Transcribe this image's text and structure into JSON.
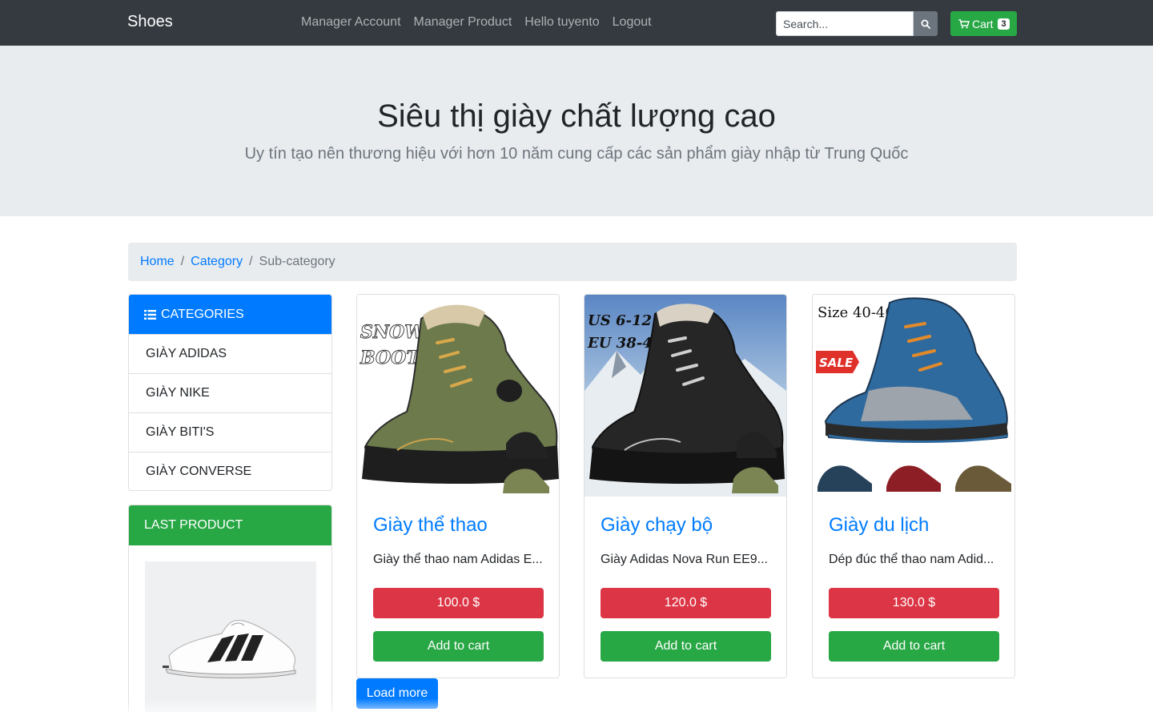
{
  "navbar": {
    "brand": "Shoes",
    "links": [
      "Manager Account",
      "Manager Product",
      "Hello tuyento",
      "Logout"
    ],
    "search_placeholder": "Search...",
    "cart_label": "Cart",
    "cart_count": "3",
    "icons": {
      "search": "search-icon",
      "cart": "cart-icon"
    }
  },
  "jumbotron": {
    "title": "Siêu thị giày chất lượng cao",
    "lead": "Uy tín tạo nên thương hiệu với hơn 10 năm cung cấp các sản phẩm giày nhập từ Trung Quốc"
  },
  "breadcrumb": {
    "home": "Home",
    "category": "Category",
    "active": "Sub-category"
  },
  "categories": {
    "header": "CATEGORIES",
    "items": [
      "GIÀY ADIDAS",
      "GIÀY NIKE",
      "GIÀY BITI'S",
      "GIÀY CONVERSE"
    ]
  },
  "last_product": {
    "header": "LAST PRODUCT"
  },
  "products": [
    {
      "title": "Giày thể thao",
      "desc": "Giày thể thao nam Adidas E...",
      "price": "100.0 $",
      "add_label": "Add to cart",
      "image_text": [
        "SNOW",
        "BOOTS"
      ]
    },
    {
      "title": "Giày chạy bộ",
      "desc": "Giày Adidas Nova Run EE9...",
      "price": "120.0 $",
      "add_label": "Add to cart",
      "image_text": [
        "US 6-12",
        "EU 38-46"
      ]
    },
    {
      "title": "Giày du lịch",
      "desc": "Dép đúc thể thao nam Adid...",
      "price": "130.0 $",
      "add_label": "Add to cart",
      "image_text": [
        "Size 40-46",
        "SALE"
      ]
    }
  ],
  "load_more": "Load more",
  "colors": {
    "navbar": "#343a40",
    "primary": "#007bff",
    "success": "#28a745",
    "danger": "#dc3545",
    "jumbotron": "#e9ecef"
  }
}
